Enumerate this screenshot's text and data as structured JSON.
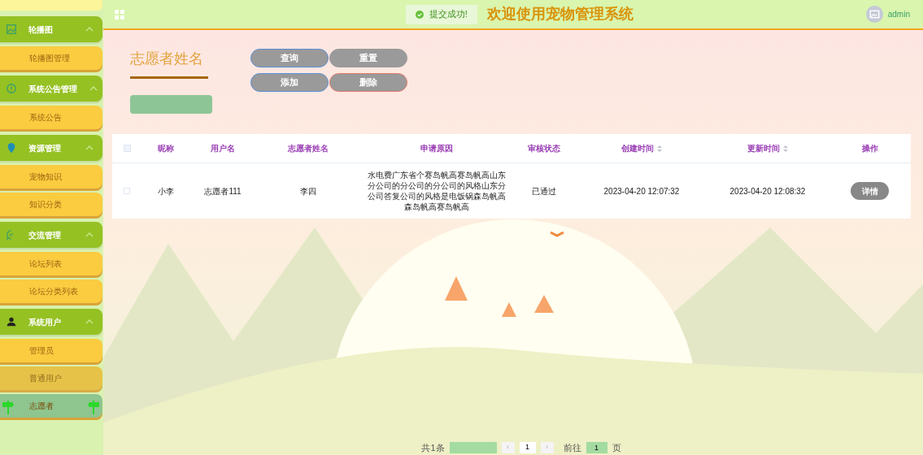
{
  "sidebar": {
    "groups": [
      {
        "label": "轮播图",
        "expanded": true,
        "items": [
          {
            "label": "轮播图管理",
            "selected": false,
            "hover": false
          }
        ]
      },
      {
        "label": "系统公告管理",
        "expanded": true,
        "items": [
          {
            "label": "系统公告",
            "selected": false,
            "hover": false
          }
        ]
      },
      {
        "label": "资源管理",
        "expanded": true,
        "items": [
          {
            "label": "宠物知识",
            "selected": false,
            "hover": false
          },
          {
            "label": "知识分类",
            "selected": false,
            "hover": false
          }
        ]
      },
      {
        "label": "交流管理",
        "expanded": true,
        "items": [
          {
            "label": "论坛列表",
            "selected": false,
            "hover": false
          },
          {
            "label": "论坛分类列表",
            "selected": false,
            "hover": false
          }
        ]
      },
      {
        "label": "系统用户",
        "expanded": true,
        "items": [
          {
            "label": "管理员",
            "selected": false,
            "hover": false
          },
          {
            "label": "普通用户",
            "selected": false,
            "hover": true
          },
          {
            "label": "志愿者",
            "selected": true,
            "hover": false
          }
        ]
      }
    ]
  },
  "header": {
    "title": "欢迎使用宠物管理系统",
    "user": "admin"
  },
  "toast": {
    "message": "提交成功!"
  },
  "search": {
    "label": "志愿者姓名"
  },
  "buttons": [
    {
      "label": "查询",
      "kind": "primary"
    },
    {
      "label": "重置",
      "kind": "plain"
    },
    {
      "label": "添加",
      "kind": "primary"
    },
    {
      "label": "删除",
      "kind": "danger"
    }
  ],
  "table": {
    "all_checked": false,
    "columns": [
      {
        "label": "昵称",
        "sortable": false
      },
      {
        "label": "用户名",
        "sortable": false
      },
      {
        "label": "志愿者姓名",
        "sortable": false
      },
      {
        "label": "申请原因",
        "sortable": false
      },
      {
        "label": "审核状态",
        "sortable": false
      },
      {
        "label": "创建时间",
        "sortable": true
      },
      {
        "label": "更新时间",
        "sortable": true
      },
      {
        "label": "操作",
        "sortable": false
      }
    ],
    "rows": [
      {
        "checked": false,
        "cells": [
          "小李",
          "志愿者111",
          "李四",
          "水电费广东省个赛岛帆高赛岛帆高山东分公司的分公司的分公司的风格山东分公司答复公司的风格是电饭锅森岛帆高森岛帆高赛岛帆高",
          "已通过",
          "2023-04-20 12:07:32",
          "2023-04-20 12:08:32"
        ],
        "action": "详情"
      }
    ]
  },
  "pagination": {
    "total": "共1条",
    "prev": "‹",
    "page": "1",
    "next": "›",
    "goto": "前往",
    "goto_value": "1",
    "unit": "页"
  }
}
